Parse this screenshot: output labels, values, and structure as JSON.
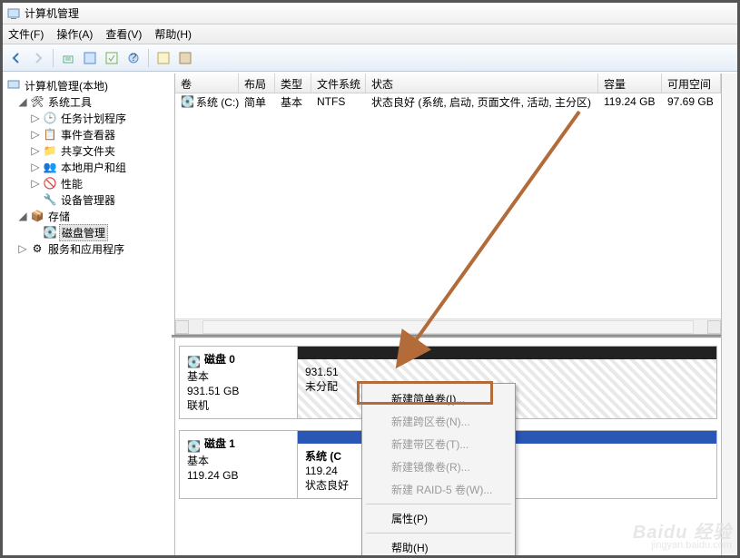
{
  "window": {
    "title": "计算机管理"
  },
  "menu": {
    "file": "文件(F)",
    "action": "操作(A)",
    "view": "查看(V)",
    "help": "帮助(H)"
  },
  "tree": {
    "root": "计算机管理(本地)",
    "sys_tools": "系统工具",
    "task_sched": "任务计划程序",
    "event_viewer": "事件查看器",
    "shared_folders": "共享文件夹",
    "local_users": "本地用户和组",
    "performance": "性能",
    "device_mgr": "设备管理器",
    "storage": "存储",
    "disk_mgmt": "磁盘管理",
    "services_apps": "服务和应用程序"
  },
  "list_header": {
    "volume": "卷",
    "layout": "布局",
    "type": "类型",
    "filesystem": "文件系统",
    "status": "状态",
    "capacity": "容量",
    "freespace": "可用空间"
  },
  "volumes": [
    {
      "name": "系统 (C:)",
      "layout": "简单",
      "type": "基本",
      "fs": "NTFS",
      "status": "状态良好 (系统, 启动, 页面文件, 活动, 主分区)",
      "capacity": "119.24 GB",
      "free": "97.69 GB"
    }
  ],
  "disks": [
    {
      "id": "磁盘 0",
      "kind": "基本",
      "size": "931.51 GB",
      "state": "联机",
      "part": {
        "size": "931.51",
        "label": "未分配"
      }
    },
    {
      "id": "磁盘 1",
      "kind": "基本",
      "size": "119.24 GB",
      "state": "",
      "part": {
        "name": "系统  (C",
        "size": "119.24",
        "status": "状态良好"
      }
    }
  ],
  "context_menu": {
    "new_simple": "新建简单卷(I)...",
    "new_span": "新建跨区卷(N)...",
    "new_stripe": "新建带区卷(T)...",
    "new_mirror": "新建镜像卷(R)...",
    "new_raid5": "新建 RAID-5 卷(W)...",
    "properties": "属性(P)",
    "help": "帮助(H)"
  },
  "watermark": {
    "brand": "Baidu 经验",
    "url": "jingyan.baidu.com"
  }
}
